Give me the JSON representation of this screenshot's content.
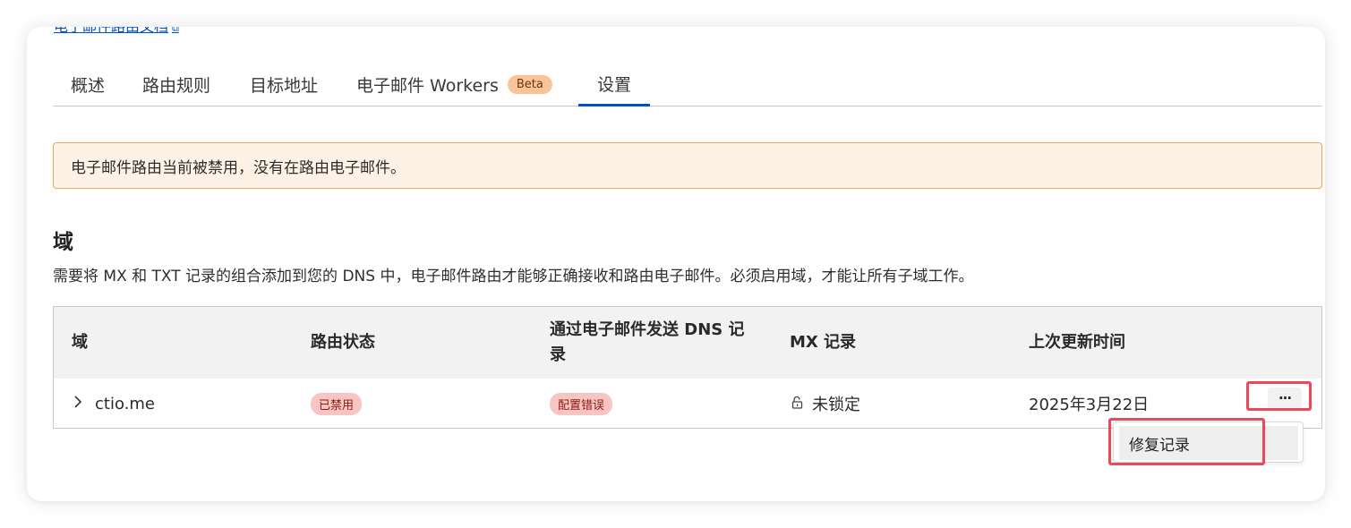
{
  "top_link": {
    "text": "电子邮件路由文档",
    "icon": "external-link-icon"
  },
  "tabs": [
    {
      "label": "概述"
    },
    {
      "label": "路由规则"
    },
    {
      "label": "目标地址"
    },
    {
      "label": "电子邮件 Workers",
      "badge": "Beta"
    },
    {
      "label": "设置",
      "active": true
    }
  ],
  "alert": {
    "text": "电子邮件路由当前被禁用，没有在路由电子邮件。"
  },
  "domain_section": {
    "title": "域",
    "description": "需要将 MX 和 TXT 记录的组合添加到您的 DNS 中，电子邮件路由才能够正确接收和路由电子邮件。必须启用域，才能让所有子域工作。"
  },
  "table": {
    "headers": [
      "域",
      "路由状态",
      "通过电子邮件发送 DNS 记录",
      "MX 记录",
      "上次更新时间"
    ],
    "rows": [
      {
        "domain": "ctio.me",
        "routing_status": "已禁用",
        "dns_records": "配置错误",
        "mx_records": "未锁定",
        "last_updated": "2025年3月22日",
        "more_label": "···"
      }
    ]
  },
  "dropdown_menu": {
    "items": [
      {
        "label": "修复记录"
      }
    ]
  },
  "colors": {
    "accent": "#0051c3",
    "warning_bg": "#fef2e6",
    "warning_border": "#f0a45f",
    "badge_beta": "#fac49a",
    "badge_error": "#f8c5c3",
    "highlight": "#e8495f"
  }
}
